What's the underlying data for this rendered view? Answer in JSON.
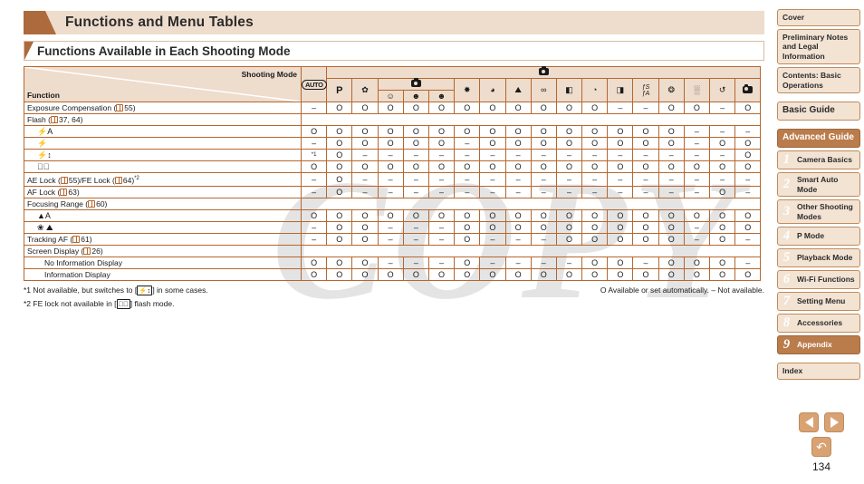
{
  "chapter": {
    "title": "Functions and Menu Tables"
  },
  "section": {
    "title": "Functions Available in Each Shooting Mode"
  },
  "table": {
    "corner_top_label": "Shooting Mode",
    "corner_bottom_label": "Function",
    "group_camera_icon": "still-camera-icon",
    "columns": [
      {
        "id": "auto",
        "icon": "auto-mode-icon",
        "label": "AUTO"
      },
      {
        "id": "p",
        "icon": "p-mode-icon",
        "label": "P"
      },
      {
        "id": "portrait",
        "icon": "portrait-mode-icon",
        "label": "✿"
      },
      {
        "id": "smile",
        "icon": "smile-mode-icon",
        "label": "☺"
      },
      {
        "id": "wink",
        "icon": "wink-self-timer-icon",
        "label": "☻"
      },
      {
        "id": "face",
        "icon": "face-self-timer-icon",
        "label": "☻"
      },
      {
        "id": "fireworks",
        "icon": "fireworks-mode-icon",
        "label": "✸"
      },
      {
        "id": "night",
        "icon": "handheld-nightscene-icon",
        "label": "◕"
      },
      {
        "id": "snow",
        "icon": "snow-mode-icon",
        "label": "⛰"
      },
      {
        "id": "toy",
        "icon": "toy-camera-icon",
        "label": "∞"
      },
      {
        "id": "mono",
        "icon": "monochrome-icon",
        "label": "◧"
      },
      {
        "id": "superviv",
        "icon": "super-vivid-icon",
        "label": "◔"
      },
      {
        "id": "poster",
        "icon": "poster-effect-icon",
        "label": "◨"
      },
      {
        "id": "fish",
        "icon": "fish-eye-icon",
        "label": "fS fA"
      },
      {
        "id": "mini",
        "icon": "miniature-effect-icon",
        "label": "❂"
      },
      {
        "id": "lowlight",
        "icon": "low-light-icon",
        "label": "░"
      },
      {
        "id": "creative",
        "icon": "creative-shot-icon",
        "label": "↺"
      },
      {
        "id": "movie",
        "icon": "movie-mode-icon",
        "label": "⎘"
      }
    ],
    "sub_group": {
      "label_icon": "self-timer-group-icon",
      "span_start": 3,
      "span_len": 3
    },
    "rows": [
      {
        "name": "Exposure Compensation (",
        "ref": "55",
        "ref_suffix": ")",
        "indent": 0,
        "type": "data",
        "values": [
          "–",
          "O",
          "O",
          "O",
          "O",
          "O",
          "O",
          "O",
          "O",
          "O",
          "O",
          "O",
          "–",
          "–",
          "O",
          "O",
          "–",
          "O"
        ]
      },
      {
        "name": "Flash (",
        "ref": "37, 64",
        "ref_suffix": ")",
        "indent": 0,
        "type": "header"
      },
      {
        "name": "Flash Auto",
        "icon": "flash-auto-icon",
        "glyph": "⚡A",
        "indent": 1,
        "type": "data",
        "values": [
          "O",
          "O",
          "O",
          "O",
          "O",
          "O",
          "O",
          "O",
          "O",
          "O",
          "O",
          "O",
          "O",
          "O",
          "O",
          "–",
          "–",
          "–"
        ]
      },
      {
        "name": "Flash On",
        "icon": "flash-on-icon",
        "glyph": "⚡",
        "indent": 1,
        "type": "data",
        "values": [
          "–",
          "O",
          "O",
          "O",
          "O",
          "O",
          "–",
          "O",
          "O",
          "O",
          "O",
          "O",
          "O",
          "O",
          "O",
          "–",
          "O",
          "O"
        ]
      },
      {
        "name": "Slow Synchro",
        "icon": "slow-synchro-icon",
        "glyph": "⚡↕",
        "indent": 1,
        "type": "data",
        "values": [
          "*1",
          "O",
          "–",
          "–",
          "–",
          "–",
          "–",
          "–",
          "–",
          "–",
          "–",
          "–",
          "–",
          "–",
          "–",
          "–",
          "–",
          "O"
        ]
      },
      {
        "name": "Flash Off",
        "icon": "flash-off-icon",
        "glyph": "⚡⃠",
        "indent": 1,
        "type": "data",
        "values": [
          "O",
          "O",
          "O",
          "O",
          "O",
          "O",
          "O",
          "O",
          "O",
          "O",
          "O",
          "O",
          "O",
          "O",
          "O",
          "O",
          "O",
          "O"
        ]
      },
      {
        "name": "AE Lock (",
        "ref": "55",
        "ref2": "64",
        "mid": ")/FE Lock (",
        "ref_suffix": ")*2",
        "indent": 0,
        "type": "data",
        "values": [
          "–",
          "O",
          "–",
          "–",
          "–",
          "–",
          "–",
          "–",
          "–",
          "–",
          "–",
          "–",
          "–",
          "–",
          "–",
          "–",
          "–",
          "–"
        ]
      },
      {
        "name": "AF Lock (",
        "ref": "63",
        "ref_suffix": ")",
        "indent": 0,
        "type": "data",
        "values": [
          "–",
          "O",
          "–",
          "–",
          "–",
          "–",
          "–",
          "–",
          "–",
          "–",
          "–",
          "–",
          "–",
          "–",
          "–",
          "–",
          "O",
          "–"
        ]
      },
      {
        "name": "Focusing Range (",
        "ref": "60",
        "ref_suffix": ")",
        "indent": 0,
        "type": "header"
      },
      {
        "name": "Normal AF",
        "icon": "normal-af-icon",
        "glyph": "▲A",
        "indent": 1,
        "type": "data",
        "values": [
          "O",
          "O",
          "O",
          "O",
          "O",
          "O",
          "O",
          "O",
          "O",
          "O",
          "O",
          "O",
          "O",
          "O",
          "O",
          "O",
          "O",
          "O"
        ]
      },
      {
        "name": "Macro / Infinity",
        "icon": "macro-infinity-icon",
        "glyph": "❀ ⛰",
        "indent": 1,
        "type": "data",
        "values": [
          "–",
          "O",
          "O",
          "–",
          "–",
          "–",
          "O",
          "O",
          "O",
          "O",
          "O",
          "O",
          "O",
          "O",
          "O",
          "–",
          "O",
          "O"
        ]
      },
      {
        "name": "Tracking AF (",
        "ref": "61",
        "ref_suffix": ")",
        "indent": 0,
        "type": "data",
        "values": [
          "–",
          "O",
          "O",
          "–",
          "–",
          "–",
          "O",
          "–",
          "–",
          "–",
          "O",
          "O",
          "O",
          "O",
          "O",
          "–",
          "O",
          "–"
        ]
      },
      {
        "name": "Screen Display (",
        "ref": "26",
        "ref_suffix": ")",
        "indent": 0,
        "type": "header"
      },
      {
        "name": "No Information Display",
        "indent": 2,
        "type": "data",
        "values": [
          "O",
          "O",
          "O",
          "–",
          "–",
          "–",
          "O",
          "–",
          "–",
          "–",
          "–",
          "O",
          "O",
          "–",
          "O",
          "O",
          "O",
          "–"
        ]
      },
      {
        "name": "Information Display",
        "indent": 2,
        "type": "data",
        "values": [
          "O",
          "O",
          "O",
          "O",
          "O",
          "O",
          "O",
          "O",
          "O",
          "O",
          "O",
          "O",
          "O",
          "O",
          "O",
          "O",
          "O",
          "O"
        ]
      }
    ]
  },
  "notes": {
    "note1_pre": "*1 Not available, but switches to [",
    "note1_glyph": "⚡↕",
    "note1_post": "] in some cases.",
    "note2_pre": "*2 FE lock not available in [",
    "note2_glyph": "⚡⃠",
    "note2_post": "] flash mode.",
    "legend": "O Available or set automatically. – Not available."
  },
  "sidebar": {
    "items": [
      {
        "label": "Cover",
        "num": "",
        "active": false,
        "big": false,
        "gap": false
      },
      {
        "label": "Preliminary Notes and Legal Information",
        "num": "",
        "active": false,
        "big": false,
        "gap": false
      },
      {
        "label": "Contents: Basic Operations",
        "num": "",
        "active": false,
        "big": false,
        "gap": false
      },
      {
        "label": "Basic Guide",
        "num": "",
        "active": false,
        "big": true,
        "gap": true
      },
      {
        "label": "Advanced Guide",
        "num": "",
        "active": true,
        "big": true,
        "gap": true
      },
      {
        "label": "Camera Basics",
        "num": "1",
        "active": false,
        "big": false,
        "gap": false
      },
      {
        "label": "Smart Auto Mode",
        "num": "2",
        "active": false,
        "big": false,
        "gap": false
      },
      {
        "label": "Other Shooting Modes",
        "num": "3",
        "active": false,
        "big": false,
        "gap": false
      },
      {
        "label": "P Mode",
        "num": "4",
        "active": false,
        "big": false,
        "gap": false
      },
      {
        "label": "Playback Mode",
        "num": "5",
        "active": false,
        "big": false,
        "gap": false
      },
      {
        "label": "Wi-Fi Functions",
        "num": "6",
        "active": false,
        "big": false,
        "gap": false
      },
      {
        "label": "Setting Menu",
        "num": "7",
        "active": false,
        "big": false,
        "gap": false
      },
      {
        "label": "Accessories",
        "num": "8",
        "active": false,
        "big": false,
        "gap": false
      },
      {
        "label": "Appendix",
        "num": "9",
        "active": true,
        "big": false,
        "gap": false
      },
      {
        "label": "Index",
        "num": "",
        "active": false,
        "big": false,
        "gap": true
      }
    ]
  },
  "footer": {
    "prev_icon": "previous-page-arrow-icon",
    "next_icon": "next-page-arrow-icon",
    "back_icon": "back-arrow-icon",
    "page_number": "134"
  },
  "watermark": {
    "text": "COPY"
  },
  "colors": {
    "accent": "#ad6a3c",
    "header_bg": "#eedccc",
    "border": "#b5672f",
    "nav_bg": "#f3e3d3",
    "nav_active": "#bb7c4c"
  }
}
